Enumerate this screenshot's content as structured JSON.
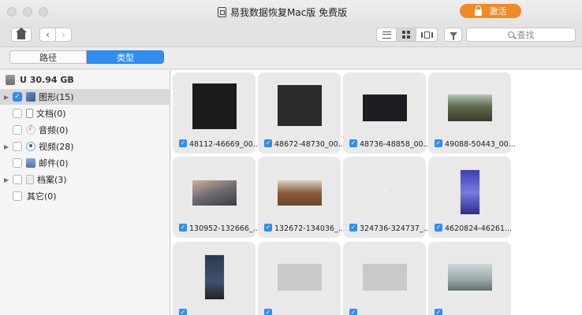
{
  "window": {
    "title": "易我数据恢复Mac版 免费版",
    "activate_label": "激活"
  },
  "toolbar": {
    "search_placeholder": "查找"
  },
  "tabs": [
    {
      "label": "路径",
      "active": false
    },
    {
      "label": "类型",
      "active": true
    }
  ],
  "sidebar": {
    "drive_label": "U 30.94 GB",
    "items": [
      {
        "label": "图形(15)",
        "checked": true,
        "expandable": true,
        "icon": "image-icon"
      },
      {
        "label": "文档(0)",
        "checked": false,
        "expandable": false,
        "icon": "document-icon"
      },
      {
        "label": "音频(0)",
        "checked": false,
        "expandable": false,
        "icon": "music-icon"
      },
      {
        "label": "视频(28)",
        "checked": false,
        "expandable": true,
        "icon": "video-icon"
      },
      {
        "label": "邮件(0)",
        "checked": false,
        "expandable": false,
        "icon": "mail-icon"
      },
      {
        "label": "档案(3)",
        "checked": false,
        "expandable": true,
        "icon": "archive-icon"
      },
      {
        "label": "其它(0)",
        "checked": false,
        "expandable": false,
        "icon": "other-icon"
      }
    ]
  },
  "files": [
    {
      "name": "48112-46669_00...",
      "checked": true
    },
    {
      "name": "48672-48730_00...",
      "checked": true
    },
    {
      "name": "48736-48858_00...",
      "checked": true
    },
    {
      "name": "49088-50443_00...",
      "checked": true
    },
    {
      "name": "130952-132666_...",
      "checked": true
    },
    {
      "name": "132672-134036_...",
      "checked": true
    },
    {
      "name": "324736-324737_...",
      "checked": true
    },
    {
      "name": "4620824-46261...",
      "checked": true
    },
    {
      "name": "",
      "checked": true
    },
    {
      "name": "",
      "checked": true
    },
    {
      "name": "",
      "checked": true
    },
    {
      "name": "",
      "checked": true
    }
  ]
}
